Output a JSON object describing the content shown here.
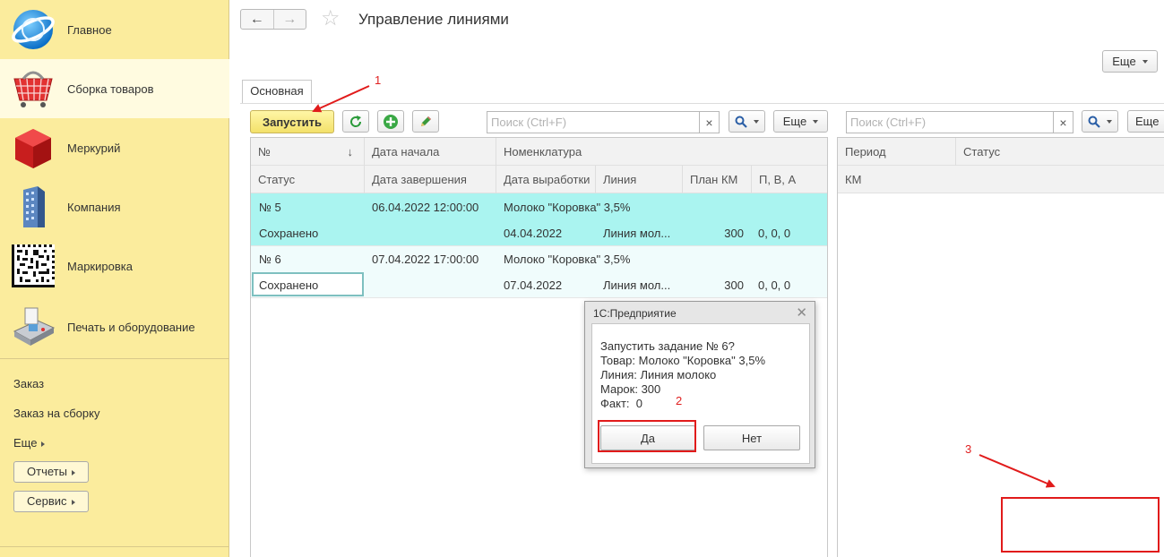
{
  "sidebar": {
    "sections": [
      {
        "label": "Главное",
        "icon": "globe-logo-icon"
      },
      {
        "label": "Сборка товаров",
        "icon": "shopping-basket-icon"
      },
      {
        "label": "Меркурий",
        "icon": "red-cube-icon"
      },
      {
        "label": "Компания",
        "icon": "office-building-icon"
      },
      {
        "label": "Маркировка",
        "icon": "datamatrix-code-icon"
      },
      {
        "label": "Печать и оборудование",
        "icon": "payment-terminal-icon"
      }
    ],
    "links": [
      "Заказ",
      "Заказ на сборку",
      "Еще"
    ],
    "buttons": [
      "Отчеты",
      "Сервис"
    ]
  },
  "header": {
    "title": "Управление линиями",
    "more_label": "Еще"
  },
  "tabs": [
    "Основная"
  ],
  "toolbar": {
    "launch_label": "Запустить",
    "search_placeholder": "Поиск (Ctrl+F)",
    "clear_glyph": "×",
    "more_label": "Еще"
  },
  "table": {
    "header_row1": [
      "№",
      "Дата начала",
      "Номенклатура"
    ],
    "header_row2": [
      "Статус",
      "Дата завершения",
      "Дата выработки",
      "Линия",
      "План КМ",
      "П, В, А"
    ],
    "rows": [
      {
        "number": "№ 5",
        "start": "06.04.2022 12:00:00",
        "product": "Молоко \"Коровка\" 3,5%",
        "status": "Сохранено",
        "end": "",
        "prod_date": "04.04.2022",
        "line": "Линия мол...",
        "plan": "300",
        "pva": "0, 0, 0"
      },
      {
        "number": "№ 6",
        "start": "07.04.2022 17:00:00",
        "product": "Молоко \"Коровка\" 3,5%",
        "status": "Сохранено",
        "end": "",
        "prod_date": "07.04.2022",
        "line": "Линия мол...",
        "plan": "300",
        "pva": "0, 0, 0"
      }
    ]
  },
  "right_panel": {
    "search_placeholder": "Поиск (Ctrl+F)",
    "clear_glyph": "×",
    "more_label": "Еще",
    "header_row1": [
      "Период",
      "Статус"
    ],
    "header_row2": [
      "КМ"
    ]
  },
  "dialog": {
    "title": "1С:Предприятие",
    "lines": [
      "Запустить задание № 6?",
      "Товар: Молоко \"Коровка\" 3,5%",
      "Линия: Линия молоко",
      "Марок: 300",
      "Факт:  0"
    ],
    "yes_label": "Да",
    "no_label": "Нет"
  },
  "annotations": [
    "1",
    "2",
    "3"
  ],
  "colors": {
    "sidebar_bg": "#fbec9d",
    "active_section_bg": "#fffbe0",
    "selected_row_bg": "#aaf4f0",
    "annotation_red": "#e11b1b",
    "launch_button": "#f7e57a"
  }
}
